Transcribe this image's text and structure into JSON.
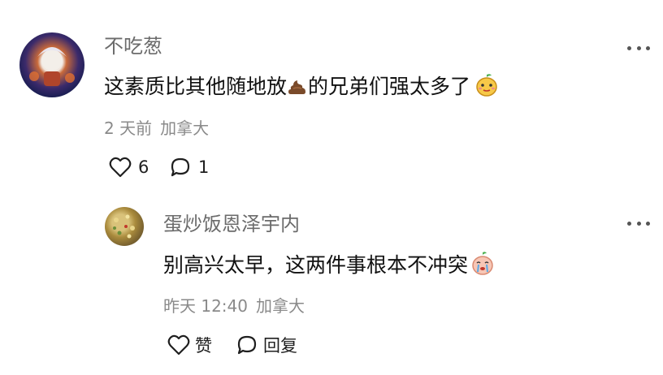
{
  "comments": [
    {
      "username": "不吃葱",
      "text_before": "这素质比其他随地放",
      "inline_emoji": "poop-emoji",
      "text_after": "的兄弟们强太多了",
      "end_emoji": "mango-emoji",
      "time": "2 天前",
      "location": "加拿大",
      "likes": "6",
      "replies": "1"
    }
  ],
  "reply": {
    "username": "蛋炒饭恩泽宇内",
    "text": "别高兴太早，这两件事根本不冲突",
    "end_emoji": "crying-peach-emoji",
    "time": "昨天 12:40",
    "location": "加拿大",
    "like_label": "赞",
    "reply_label": "回复"
  }
}
